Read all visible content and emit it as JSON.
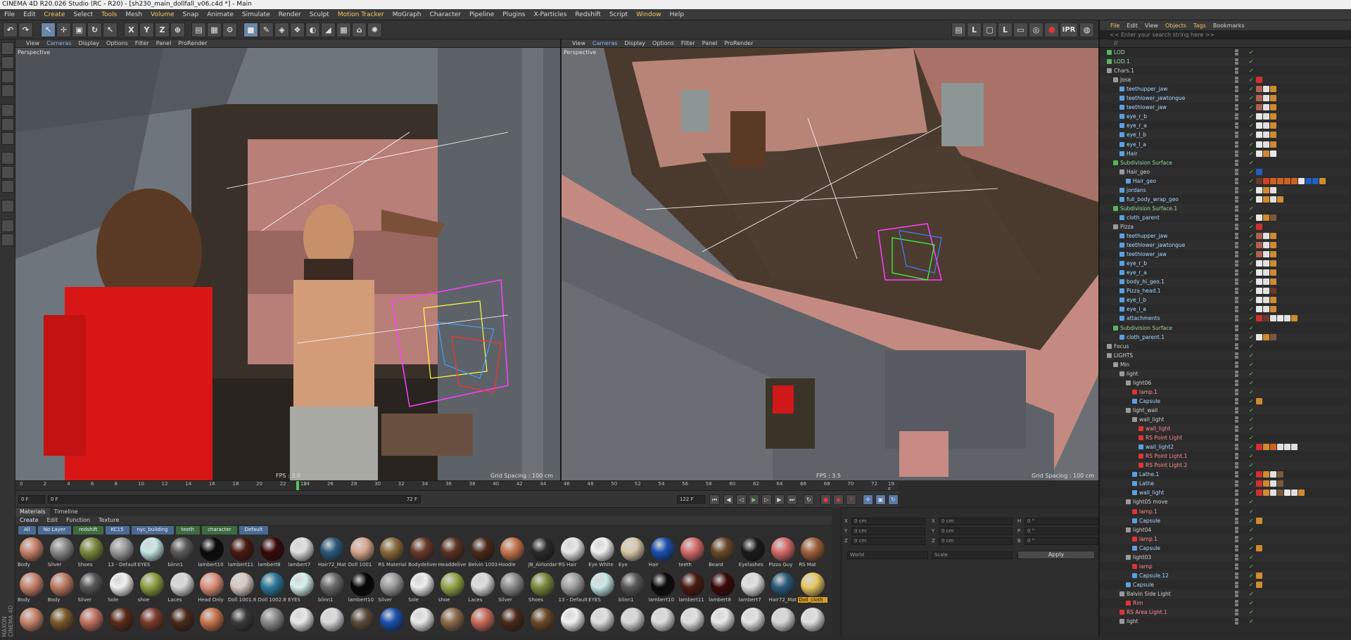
{
  "window": {
    "title": "CINEMA 4D R20.026 Studio (RC - R20) - [sh230_main_dollfall_v06.c4d *] - Main"
  },
  "menu": [
    "File",
    "Edit",
    "Create",
    "Select",
    "Tools",
    "Mesh",
    "Volume",
    "Snap",
    "Animate",
    "Simulate",
    "Render",
    "Sculpt",
    "Motion Tracker",
    "MoGraph",
    "Character",
    "Pipeline",
    "Plugins",
    "X-Particles",
    "Redshift",
    "Script",
    "Window",
    "Help"
  ],
  "toolbar": {
    "ipr_label": "IPR"
  },
  "viewport_left": {
    "menu": [
      "View",
      "Cameras",
      "Display",
      "Options",
      "Filter",
      "Panel",
      "ProRender"
    ],
    "label": "Perspective",
    "fps": "FPS : 3.0",
    "grid": "Grid Spacing : 100 cm"
  },
  "viewport_right": {
    "menu": [
      "View",
      "Cameras",
      "Display",
      "Options",
      "Filter",
      "Panel",
      "ProRender"
    ],
    "label": "Perspective",
    "fps": "FPS : 3.5",
    "grid": "Grid Spacing : 100 cm"
  },
  "timeline": {
    "ticks": [
      "0",
      "2",
      "4",
      "6",
      "8",
      "10",
      "12",
      "14",
      "16",
      "18",
      "20",
      "22",
      "24",
      "26",
      "28",
      "30",
      "32",
      "34",
      "36",
      "38",
      "40",
      "42",
      "44",
      "46",
      "48",
      "50",
      "52",
      "54",
      "56",
      "58",
      "60",
      "62",
      "64",
      "66",
      "68",
      "70",
      "72"
    ],
    "current_frame_marker": "19",
    "frame_end_marker": "19 F"
  },
  "playbar": {
    "start_field": "0 F",
    "min_field": "0 F",
    "max_field": "72 F",
    "end_field": "122 F"
  },
  "materials": {
    "tabs": [
      "Materials",
      "Timeline"
    ],
    "menu": [
      "Create",
      "Edit",
      "Function",
      "Texture"
    ],
    "layers": [
      "All",
      "No Layer",
      "redshift",
      "KC15",
      "nyc_building",
      "teeth",
      "character",
      "Default"
    ],
    "items": [
      {
        "name": "Body",
        "color": "#c8826a"
      },
      {
        "name": "Silver",
        "color": "#8a8a8a"
      },
      {
        "name": "Shoes",
        "color": "#7a8a3a"
      },
      {
        "name": "13 - Default",
        "color": "#9a9a9a"
      },
      {
        "name": "EYES",
        "color": "#c8e8e8"
      },
      {
        "name": "blinn1",
        "color": "#5a5a5a"
      },
      {
        "name": "lambert10",
        "color": "#0a0a0a"
      },
      {
        "name": "lambert11",
        "color": "#4a1a10"
      },
      {
        "name": "lambert8",
        "color": "#3a0808"
      },
      {
        "name": "lambert7",
        "color": "#e0e0e0"
      },
      {
        "name": "Hair72_Mat",
        "color": "#2a5a7a"
      },
      {
        "name": "Doll 1001",
        "color": "#d8a890"
      },
      {
        "name": "RS Material",
        "color": "#8a6a3a"
      },
      {
        "name": "Bodydeliverr",
        "color": "#6a3a2a"
      },
      {
        "name": "Headdelive",
        "color": "#5a3222"
      },
      {
        "name": "Belvin 1003",
        "color": "#4a2a1a"
      },
      {
        "name": "Hoodie",
        "color": "#c8744a"
      },
      {
        "name": "JB_Airlordan",
        "color": "#2a2a2a"
      },
      {
        "name": "RS Hair",
        "color": "#e8e8e8"
      },
      {
        "name": "Eye White",
        "color": "#f0f0f0"
      },
      {
        "name": "Eye",
        "color": "#d8c8a8"
      },
      {
        "name": "Hair",
        "color": "#1a50b0"
      },
      {
        "name": "teeth",
        "color": "#d86a6a"
      },
      {
        "name": "Beard",
        "color": "#6a4a2a"
      },
      {
        "name": "Eyelashes",
        "color": "#1a1a1a"
      },
      {
        "name": "Pizza Guy",
        "color": "#d86a6a"
      },
      {
        "name": "RS Mat",
        "color": "#a0603a"
      },
      {
        "name": "Body",
        "color": "#c8826a"
      },
      {
        "name": "Body",
        "color": "#c07a62"
      },
      {
        "name": "Silver",
        "color": "#555555"
      },
      {
        "name": "Sole",
        "color": "#f0f0f0"
      },
      {
        "name": "shoe",
        "color": "#8aa040"
      },
      {
        "name": "Laces",
        "color": "#d8d8d8"
      },
      {
        "name": "Head Only",
        "color": "#e0907a"
      },
      {
        "name": "Doll 1001.8",
        "color": "#d8c8c0"
      },
      {
        "name": "Doll 1002.8",
        "color": "#2a7a9a"
      },
      {
        "name": "EYES",
        "color": "#d8f0f0"
      },
      {
        "name": "blinn1",
        "color": "#6a6a6a"
      },
      {
        "name": "lambert10",
        "color": "#050505"
      },
      {
        "name": "Silver",
        "color": "#9a9a9a"
      },
      {
        "name": "Sole",
        "color": "#ededed"
      },
      {
        "name": "shoe",
        "color": "#90a848"
      },
      {
        "name": "Laces",
        "color": "#dcdcdc"
      },
      {
        "name": "Silver",
        "color": "#8c8c8c"
      },
      {
        "name": "Shoes",
        "color": "#7a8a3a"
      },
      {
        "name": "13 - Default",
        "color": "#a0a0a0"
      },
      {
        "name": "EYES",
        "color": "#c8e8e8"
      },
      {
        "name": "blinn1",
        "color": "#585858"
      },
      {
        "name": "lambert10",
        "color": "#0a0a0a"
      },
      {
        "name": "lambert11",
        "color": "#4a1a10"
      },
      {
        "name": "lambert8",
        "color": "#3a0808"
      },
      {
        "name": "lambert7",
        "color": "#e0e0e0"
      },
      {
        "name": "Hair72_Mat",
        "color": "#2a5a7a"
      },
      {
        "name": "Doll_cloth",
        "color": "#e8c860"
      },
      {
        "name": "",
        "color": "#c8826a"
      },
      {
        "name": "",
        "color": "#7a5a2a"
      },
      {
        "name": "",
        "color": "#c07060"
      },
      {
        "name": "",
        "color": "#5a2a1a"
      },
      {
        "name": "",
        "color": "#7a3a2a"
      },
      {
        "name": "",
        "color": "#4a2a1a"
      },
      {
        "name": "",
        "color": "#c8744a"
      },
      {
        "name": "",
        "color": "#3a3a3a"
      },
      {
        "name": "",
        "color": "#8a8a8a"
      },
      {
        "name": "",
        "color": "#e8e8e8"
      },
      {
        "name": "",
        "color": "#dadada"
      },
      {
        "name": "",
        "color": "#5a4a3a"
      },
      {
        "name": "",
        "color": "#1a50b0"
      },
      {
        "name": "",
        "color": "#e8e8e8"
      },
      {
        "name": "",
        "color": "#8a6a4a"
      },
      {
        "name": "",
        "color": "#c86a5a"
      },
      {
        "name": "",
        "color": "#4a2a1a"
      },
      {
        "name": "",
        "color": "#6a4a2a"
      },
      {
        "name": "",
        "color": "#f0f0f0"
      },
      {
        "name": "",
        "color": "#e0e0e0"
      },
      {
        "name": "",
        "color": "#d8d8d8"
      },
      {
        "name": "",
        "color": "#dcdcdc"
      },
      {
        "name": "",
        "color": "#e0e0e0"
      },
      {
        "name": "",
        "color": "#e8e8e8"
      },
      {
        "name": "",
        "color": "#e4e4e4"
      },
      {
        "name": "",
        "color": "#d8d8d8"
      },
      {
        "name": "",
        "color": "#e0e0e0"
      }
    ]
  },
  "coordinates": {
    "rows": [
      {
        "a": "X",
        "av": "0 cm",
        "b": "X",
        "bv": "0 cm",
        "c": "H",
        "cv": "0 °"
      },
      {
        "a": "Y",
        "av": "0 cm",
        "b": "Y",
        "bv": "0 cm",
        "c": "P",
        "cv": "0 °"
      },
      {
        "a": "Z",
        "av": "0 cm",
        "b": "Z",
        "bv": "0 cm",
        "c": "B",
        "cv": "0 °"
      }
    ],
    "mode1": "World",
    "mode2": "Scale",
    "apply_label": "Apply"
  },
  "object_manager": {
    "menu": [
      "File",
      "Edit",
      "View",
      "Objects",
      "Tags",
      "Bookmarks"
    ],
    "search_placeholder": "<< Enter your search string here >>",
    "path": "//",
    "rows": [
      {
        "name": "LOD",
        "indent": 0,
        "kind": "green",
        "tags": []
      },
      {
        "name": "LOD.1",
        "indent": 0,
        "kind": "green",
        "tags": []
      },
      {
        "name": "Chars.1",
        "indent": 0,
        "kind": "null",
        "tags": []
      },
      {
        "name": "Jose",
        "indent": 1,
        "kind": "null",
        "tags": [
          "#d03030"
        ]
      },
      {
        "name": "teethupper_jaw",
        "indent": 2,
        "kind": "obj",
        "tags": [
          "#b06050",
          "#e0e0e0",
          "#d08a30"
        ]
      },
      {
        "name": "teethlower_jawtongue",
        "indent": 2,
        "kind": "obj",
        "tags": [
          "#b06050",
          "#e0e0e0",
          "#d08a30"
        ]
      },
      {
        "name": "teethlower_jaw",
        "indent": 2,
        "kind": "obj",
        "tags": [
          "#b06050",
          "#e0e0e0",
          "#d08a30"
        ]
      },
      {
        "name": "eye_r_b",
        "indent": 2,
        "kind": "obj",
        "tags": [
          "#e8e8e8",
          "#e0e0e0",
          "#d08a30"
        ]
      },
      {
        "name": "eye_r_a",
        "indent": 2,
        "kind": "obj",
        "tags": [
          "#e8e8e8",
          "#e0e0e0",
          "#d08a30"
        ]
      },
      {
        "name": "eye_l_b",
        "indent": 2,
        "kind": "obj",
        "tags": [
          "#e8e8e8",
          "#e0e0e0",
          "#d08a30"
        ]
      },
      {
        "name": "eye_l_a",
        "indent": 2,
        "kind": "obj",
        "tags": [
          "#e8e8e8",
          "#e0e0e0",
          "#d08a30"
        ]
      },
      {
        "name": "Hair",
        "indent": 2,
        "kind": "obj",
        "tags": [
          "#e8e8e8",
          "#d08a30",
          "#e8e8e8"
        ]
      },
      {
        "name": "Subdivision Surface",
        "indent": 1,
        "kind": "green",
        "tags": []
      },
      {
        "name": "Hair_geo",
        "indent": 2,
        "kind": "null",
        "tags": [
          "#2060c0"
        ]
      },
      {
        "name": "Hair_geo",
        "indent": 3,
        "kind": "obj",
        "tags": [
          "#6a3a2a",
          "#d04020",
          "#d06020",
          "#d06020",
          "#d06020",
          "#d06020",
          "#e8e8e8",
          "#2060c0",
          "#2060c0",
          "#d08a30"
        ]
      },
      {
        "name": "jordans",
        "indent": 2,
        "kind": "obj",
        "tags": [
          "#e8e8e8",
          "#d08a30",
          "#e0e0e0",
          "#333333"
        ]
      },
      {
        "name": "full_body_wrap_geo",
        "indent": 2,
        "kind": "obj",
        "tags": [
          "#e8e8e8",
          "#d08a30",
          "#e0e0e0",
          "#d08a30"
        ]
      },
      {
        "name": "Subdivision Surface.1",
        "indent": 1,
        "kind": "green",
        "tags": []
      },
      {
        "name": "cloth_parent",
        "indent": 2,
        "kind": "obj",
        "tags": [
          "#e8e8e8",
          "#d08a30",
          "#7a5a3a"
        ]
      },
      {
        "name": "Pizza",
        "indent": 1,
        "kind": "null",
        "tags": [
          "#d03030"
        ]
      },
      {
        "name": "teethupper_jaw",
        "indent": 2,
        "kind": "obj",
        "tags": [
          "#b06050",
          "#e0e0e0",
          "#d08a30"
        ]
      },
      {
        "name": "teethlower_jawtongue",
        "indent": 2,
        "kind": "obj",
        "tags": [
          "#b06050",
          "#e0e0e0",
          "#d08a30"
        ]
      },
      {
        "name": "teethlower_jaw",
        "indent": 2,
        "kind": "obj",
        "tags": [
          "#b06050",
          "#e0e0e0",
          "#d08a30"
        ]
      },
      {
        "name": "eye_r_b",
        "indent": 2,
        "kind": "obj",
        "tags": [
          "#e8e8e8",
          "#e0e0e0",
          "#d08a30"
        ]
      },
      {
        "name": "eye_r_a",
        "indent": 2,
        "kind": "obj",
        "tags": [
          "#e8e8e8",
          "#e0e0e0",
          "#d08a30"
        ]
      },
      {
        "name": "body_hi_geo.1",
        "indent": 2,
        "kind": "obj",
        "tags": [
          "#e8e8e8",
          "#e0e0e0",
          "#d08a30"
        ]
      },
      {
        "name": "Pizza_head.1",
        "indent": 2,
        "kind": "obj",
        "tags": [
          "#e8e8e8",
          "#e0e0e0",
          "#6a3a2a"
        ]
      },
      {
        "name": "eye_l_b",
        "indent": 2,
        "kind": "obj",
        "tags": [
          "#e8e8e8",
          "#e0e0e0",
          "#d08a30"
        ]
      },
      {
        "name": "eye_l_a",
        "indent": 2,
        "kind": "obj",
        "tags": [
          "#e8e8e8",
          "#e0e0e0",
          "#d08a30"
        ]
      },
      {
        "name": "attachments",
        "indent": 2,
        "kind": "obj",
        "tags": [
          "#d03030",
          "#6a3a2a",
          "#e0e0e0",
          "#e8e8e8",
          "#e0e0e0",
          "#d08a30"
        ]
      },
      {
        "name": "Subdivision Surface",
        "indent": 1,
        "kind": "green",
        "tags": []
      },
      {
        "name": "cloth_parent.1",
        "indent": 2,
        "kind": "obj",
        "tags": [
          "#e8e8e8",
          "#d08a30",
          "#7a5a3a"
        ]
      },
      {
        "name": "Focus",
        "indent": 0,
        "kind": "null",
        "tags": []
      },
      {
        "name": "LIGHTS",
        "indent": 0,
        "kind": "null",
        "tags": []
      },
      {
        "name": "Min",
        "indent": 1,
        "kind": "null",
        "tags": []
      },
      {
        "name": "light",
        "indent": 2,
        "kind": "null",
        "tags": []
      },
      {
        "name": "light06",
        "indent": 3,
        "kind": "null",
        "tags": []
      },
      {
        "name": "lamp.1",
        "indent": 4,
        "kind": "red",
        "tags": []
      },
      {
        "name": "Capsule",
        "indent": 4,
        "kind": "obj",
        "tags": [
          "#d08a30"
        ]
      },
      {
        "name": "light_wall",
        "indent": 3,
        "kind": "null",
        "tags": []
      },
      {
        "name": "wall_light",
        "indent": 4,
        "kind": "null",
        "tags": []
      },
      {
        "name": "wall_light",
        "indent": 5,
        "kind": "red",
        "tags": []
      },
      {
        "name": "RS Point Light",
        "indent": 5,
        "kind": "red",
        "tags": []
      },
      {
        "name": "wall_light2",
        "indent": 5,
        "kind": "obj",
        "tags": [
          "#d03030",
          "#d08a30",
          "#d06020",
          "#e0e0e0",
          "#e0e0e0",
          "#e0e0e0"
        ]
      },
      {
        "name": "RS Point Light.1",
        "indent": 5,
        "kind": "red",
        "tags": []
      },
      {
        "name": "RS Point Light.2",
        "indent": 5,
        "kind": "red",
        "tags": []
      },
      {
        "name": "Lathe.1",
        "indent": 4,
        "kind": "obj",
        "tags": [
          "#d03030",
          "#d08a30",
          "#e0e0e0",
          "#7a5a3a"
        ]
      },
      {
        "name": "Lathe",
        "indent": 4,
        "kind": "obj",
        "tags": [
          "#d03030",
          "#d08a30",
          "#e0e0e0",
          "#7a5a3a"
        ]
      },
      {
        "name": "wall_light",
        "indent": 4,
        "kind": "obj",
        "tags": [
          "#d03030",
          "#d08a30",
          "#e0e0e0",
          "#7a5a3a",
          "#e8e8e8",
          "#e0e0e0",
          "#d08a30"
        ]
      },
      {
        "name": "light05 move",
        "indent": 3,
        "kind": "null",
        "tags": []
      },
      {
        "name": "lamp.1",
        "indent": 4,
        "kind": "red",
        "tags": []
      },
      {
        "name": "Capsule",
        "indent": 4,
        "kind": "obj",
        "tags": [
          "#d08a30"
        ]
      },
      {
        "name": "light04",
        "indent": 3,
        "kind": "null",
        "tags": []
      },
      {
        "name": "lamp.1",
        "indent": 4,
        "kind": "red",
        "tags": []
      },
      {
        "name": "Capsule",
        "indent": 4,
        "kind": "obj",
        "tags": [
          "#d08a30"
        ]
      },
      {
        "name": "light03",
        "indent": 3,
        "kind": "null",
        "tags": []
      },
      {
        "name": "lamp",
        "indent": 4,
        "kind": "red",
        "tags": []
      },
      {
        "name": "Capsule.12",
        "indent": 4,
        "kind": "obj",
        "tags": [
          "#d08a30"
        ]
      },
      {
        "name": "Capsule",
        "indent": 3,
        "kind": "obj",
        "tags": [
          "#d08a30"
        ]
      },
      {
        "name": "Balvin Side Light",
        "indent": 2,
        "kind": "null",
        "tags": []
      },
      {
        "name": "Rim",
        "indent": 3,
        "kind": "red",
        "tags": []
      },
      {
        "name": "RS Area Light.1",
        "indent": 2,
        "kind": "red",
        "tags": []
      },
      {
        "name": "light",
        "indent": 2,
        "kind": "null",
        "tags": []
      }
    ]
  },
  "colors": {
    "accent": "#6c86a8",
    "layer_blue": "#4b6a93",
    "selection": "#d6a022"
  }
}
